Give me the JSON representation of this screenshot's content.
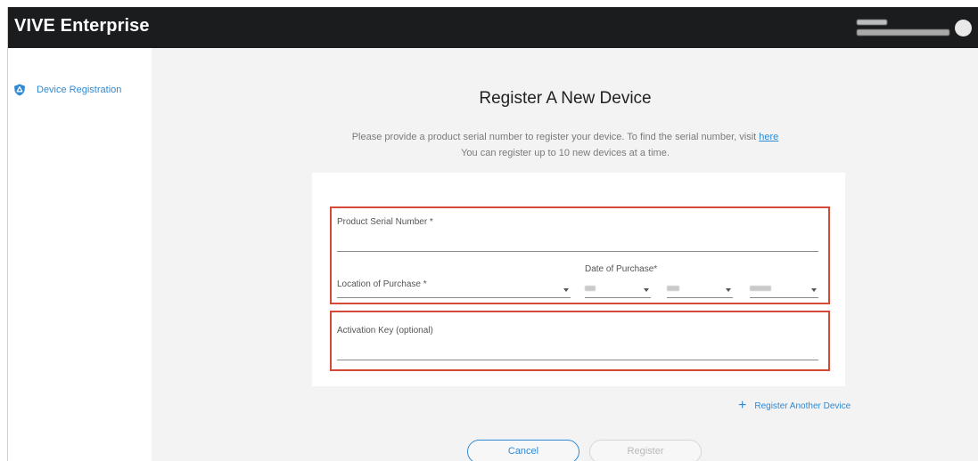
{
  "header": {
    "brand": "VIVE Enterprise"
  },
  "sidebar": {
    "items": [
      {
        "label": "Device Registration",
        "icon": "shield-icon"
      }
    ]
  },
  "page": {
    "title": "Register A New Device",
    "description_prefix": "Please provide a product serial number to register your device. To find the serial number, visit ",
    "description_link": "here",
    "description_line2": "You can register up to 10 new devices at a time."
  },
  "form": {
    "serial_label": "Product Serial Number *",
    "serial_value": "",
    "location_label": "Location of Purchase *",
    "date_label": "Date of Purchase*",
    "activation_label": "Activation Key (optional)",
    "activation_value": ""
  },
  "actions": {
    "add_device": "Register Another Device",
    "cancel": "Cancel",
    "register": "Register"
  },
  "colors": {
    "topbar": "#1b1c1e",
    "accent": "#2f8ad3",
    "highlight": "#d44a37",
    "background": "#f3f3f3"
  }
}
